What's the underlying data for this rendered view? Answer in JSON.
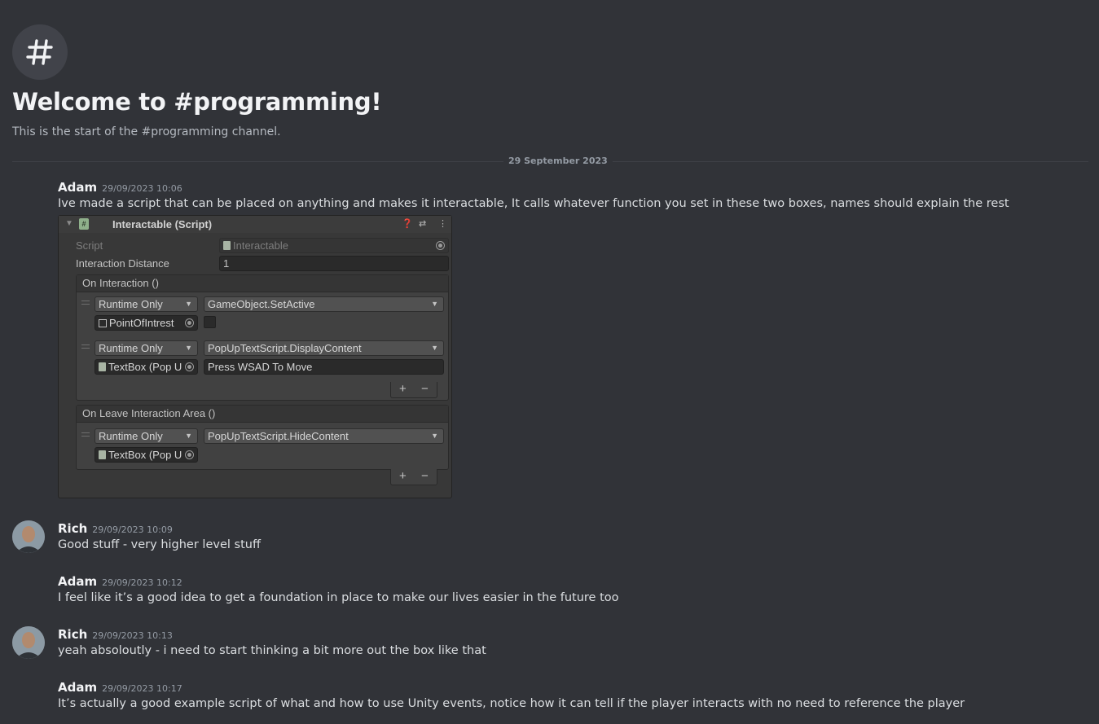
{
  "welcome": {
    "title": "Welcome to #programming!",
    "subtitle": "This is the start of the #programming channel.",
    "icon": "hashtag-icon"
  },
  "divider": {
    "date": "29 September 2023"
  },
  "messages": [
    {
      "author": "Adam",
      "time": "29/09/2023 10:06",
      "text": "Ive made a script that can be placed on anything and makes it interactable, It calls whatever function you set in these two boxes, names should explain the rest"
    },
    {
      "author": "Rich",
      "time": "29/09/2023 10:09",
      "text": "Good stuff - very higher level stuff"
    },
    {
      "author": "Adam",
      "time": "29/09/2023 10:12",
      "text": "I feel like it’s a good idea to get a foundation in place to make our lives easier in the future too"
    },
    {
      "author": "Rich",
      "time": "29/09/2023 10:13",
      "text": "yeah absoloutly - i need to start thinking a bit more out the box like that"
    },
    {
      "author": "Adam",
      "time": "29/09/2023 10:17",
      "text": "It’s actually a good example script of what and how to use Unity events, notice how it can tell if the player interacts with no need to reference the player"
    }
  ],
  "inspector": {
    "title": "Interactable (Script)",
    "script_label": "Script",
    "script_value": "Interactable",
    "distance_label": "Interaction Distance",
    "distance_value": "1",
    "on_interaction": {
      "header": "On Interaction ()",
      "rows": [
        {
          "mode": "Runtime Only",
          "function": "GameObject.SetActive",
          "target": "PointOfIntrest",
          "arg": ""
        },
        {
          "mode": "Runtime Only",
          "function": "PopUpTextScript.DisplayContent",
          "target": "TextBox (Pop U",
          "arg": "Press WSAD To Move"
        }
      ]
    },
    "on_leave": {
      "header": "On Leave Interaction Area ()",
      "rows": [
        {
          "mode": "Runtime Only",
          "function": "PopUpTextScript.HideContent",
          "target": "TextBox (Pop U"
        }
      ]
    },
    "plus": "+",
    "minus": "−"
  }
}
